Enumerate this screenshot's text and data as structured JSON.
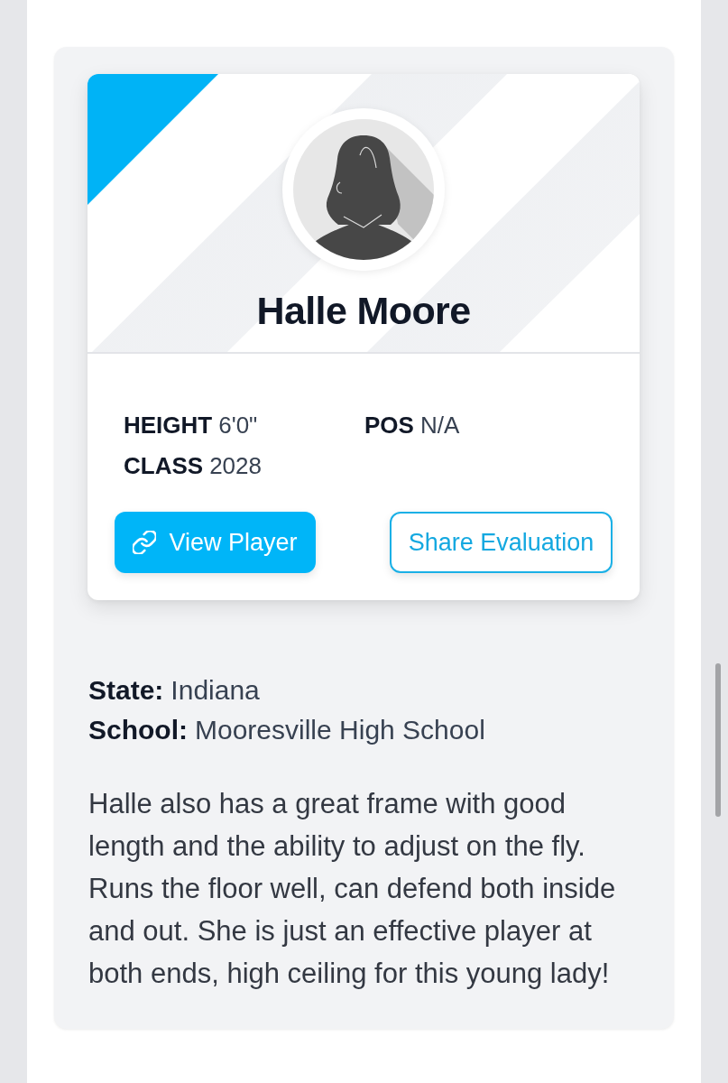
{
  "player": {
    "name": "Halle Moore",
    "stats": [
      {
        "label": "HEIGHT",
        "value": "6'0\""
      },
      {
        "label": "POS",
        "value": "N/A"
      },
      {
        "label": "CLASS",
        "value": "2028"
      }
    ],
    "buttons": [
      {
        "kind": "primary",
        "label": "View Player"
      },
      {
        "kind": "outline",
        "label": "Share Evaluation"
      }
    ]
  },
  "details": [
    {
      "label": "State:",
      "value": "Indiana"
    },
    {
      "label": "School:",
      "value": "Mooresville High School"
    }
  ],
  "evaluation": "Halle also has a great frame with good length and the ability to adjust on the fly. Runs the floor well, can defend both inside and out. She is just an effective player at both ends, high ceiling for this young lady!"
}
